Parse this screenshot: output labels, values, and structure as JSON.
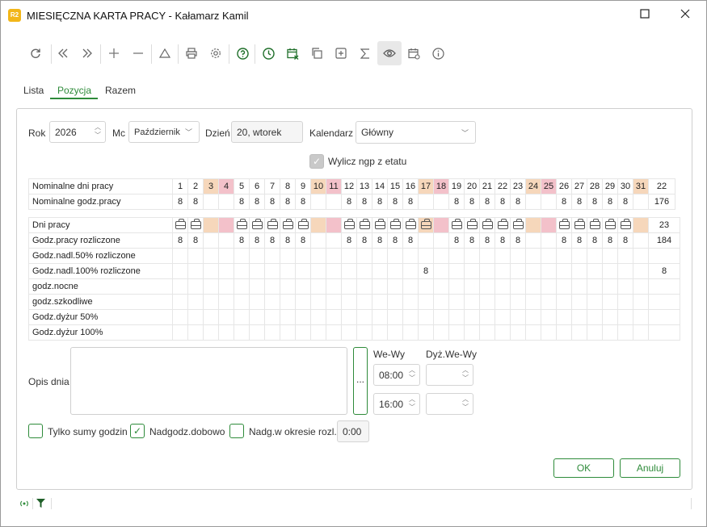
{
  "window": {
    "title": "MIESIĘCZNA KARTA PRACY - Kałamarz Kamil",
    "app_icon_text": "R2"
  },
  "toolbar": {
    "icons": [
      "refresh-icon",
      "first-icon",
      "last-icon",
      "add-icon",
      "remove-icon",
      "warning-icon",
      "print-icon",
      "settings-icon",
      "help-icon",
      "clock-icon",
      "calendar-delete-icon",
      "copy-icon",
      "add-box-icon",
      "sum-icon",
      "eye-icon",
      "calendar-settings-icon",
      "info-icon"
    ]
  },
  "tabs": [
    "Lista",
    "Pozycja",
    "Razem"
  ],
  "form": {
    "rok_label": "Rok",
    "rok_value": "2026",
    "mc_label": "Mc",
    "mc_value": "Październik",
    "dzien_label": "Dzień",
    "dzien_value": "20, wtorek",
    "kalendarz_label": "Kalendarz",
    "kalendarz_value": "Główny",
    "wylicz_label": "Wylicz ngp z etatu"
  },
  "grid": {
    "days": [
      "1",
      "2",
      "3",
      "4",
      "5",
      "6",
      "7",
      "8",
      "9",
      "10",
      "11",
      "12",
      "13",
      "14",
      "15",
      "16",
      "17",
      "18",
      "19",
      "20",
      "21",
      "22",
      "23",
      "24",
      "25",
      "26",
      "27",
      "28",
      "29",
      "30",
      "31"
    ],
    "day_types": [
      "w",
      "w",
      "s",
      "h",
      "w",
      "w",
      "w",
      "w",
      "w",
      "s",
      "h",
      "w",
      "w",
      "w",
      "w",
      "w",
      "s",
      "h",
      "w",
      "w",
      "w",
      "w",
      "w",
      "s",
      "h",
      "w",
      "w",
      "w",
      "w",
      "w",
      "s"
    ],
    "nominal_rows": [
      {
        "label": "Nominalne dni pracy",
        "total": "22"
      },
      {
        "label": "Nominalne godz.pracy",
        "values": [
          "8",
          "8",
          "",
          "",
          "8",
          "8",
          "8",
          "8",
          "8",
          "",
          "",
          "8",
          "8",
          "8",
          "8",
          "8",
          "",
          "",
          "8",
          "8",
          "8",
          "8",
          "8",
          "",
          "",
          "8",
          "8",
          "8",
          "8",
          "8",
          ""
        ],
        "total": "176"
      }
    ],
    "work_rows": [
      {
        "label": "Dni pracy",
        "bags": [
          1,
          1,
          0,
          0,
          1,
          1,
          1,
          1,
          1,
          0,
          0,
          1,
          1,
          1,
          1,
          1,
          1,
          0,
          1,
          1,
          1,
          1,
          1,
          0,
          0,
          1,
          1,
          1,
          1,
          1,
          0
        ],
        "total": "23"
      },
      {
        "label": "Godz.pracy rozliczone",
        "values": [
          "8",
          "8",
          "",
          "",
          "8",
          "8",
          "8",
          "8",
          "8",
          "",
          "",
          "8",
          "8",
          "8",
          "8",
          "8",
          "",
          "",
          "8",
          "8",
          "8",
          "8",
          "8",
          "",
          "",
          "8",
          "8",
          "8",
          "8",
          "8",
          ""
        ],
        "total": "184"
      },
      {
        "label": "Godz.nadl.50% rozliczone",
        "values": [],
        "total": ""
      },
      {
        "label": "Godz.nadl.100% rozliczone",
        "values": [
          "",
          "",
          "",
          "",
          "",
          "",
          "",
          "",
          "",
          "",
          "",
          "",
          "",
          "",
          "",
          "",
          "8",
          "",
          "",
          "",
          "",
          "",
          "",
          "",
          "",
          "",
          "",
          "",
          "",
          "",
          ""
        ],
        "total": "8"
      },
      {
        "label": "godz.nocne",
        "values": [],
        "total": ""
      },
      {
        "label": "godz.szkodliwe",
        "values": [],
        "total": ""
      },
      {
        "label": "Godz.dyżur 50%",
        "values": [],
        "total": ""
      },
      {
        "label": "Godz.dyżur 100%",
        "values": [],
        "total": ""
      }
    ]
  },
  "opis": {
    "label": "Opis dnia",
    "ellipsis": "...",
    "we_wy_label": "We-Wy",
    "dyz_label": "Dyż.We-Wy",
    "we_value": "08:00",
    "wy_value": "16:00",
    "dyz_we_value": "",
    "dyz_wy_value": ""
  },
  "options": {
    "tylko_sumy_label": "Tylko sumy godzin",
    "nadgodz_dobowo_label": "Nadgodz.dobowo",
    "nadg_okres_label": "Nadg.w okresie rozl.",
    "nadg_okres_value": "0:00"
  },
  "buttons": {
    "ok": "OK",
    "anuluj": "Anuluj"
  },
  "colors": {
    "accent": "#2e8b3a",
    "saturday": "#f6d7bb",
    "holiday": "#f3c1ca"
  }
}
